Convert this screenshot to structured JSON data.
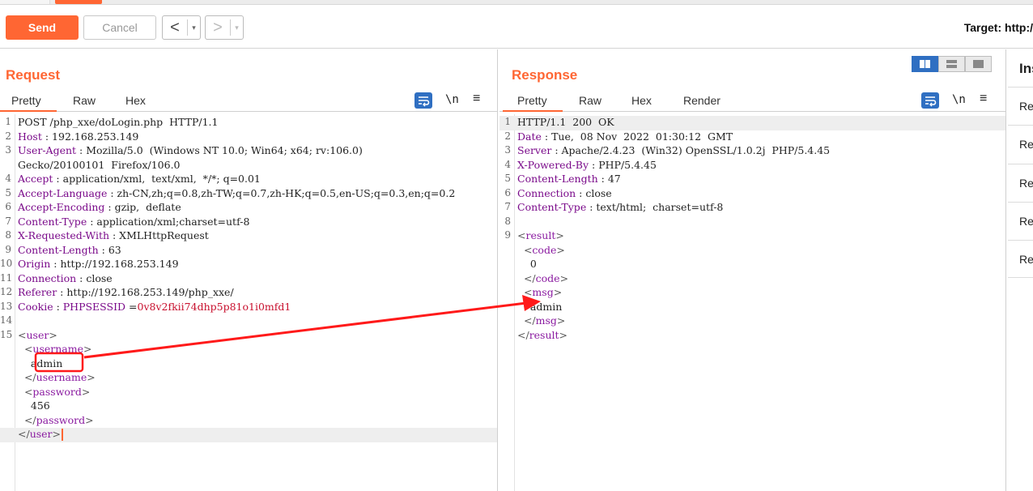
{
  "toolbar": {
    "send_label": "Send",
    "cancel_label": "Cancel",
    "back_arrow": "<",
    "fwd_arrow": ">",
    "drop_glyph": "▾",
    "target_label": "Target: http:/"
  },
  "request": {
    "title": "Request",
    "tabs": [
      "Pretty",
      "Raw",
      "Hex"
    ],
    "lines": [
      {
        "n": "1",
        "parts": [
          {
            "t": "POST /php_xxe/doLogin.php  HTTP/1.1"
          }
        ]
      },
      {
        "n": "2",
        "parts": [
          {
            "t": "Host",
            "c": "hk"
          },
          {
            "t": " : 192.168.253.149"
          }
        ]
      },
      {
        "n": "3",
        "parts": [
          {
            "t": "User-Agent",
            "c": "hk"
          },
          {
            "t": " : Mozilla/5.0  (Windows NT 10.0; Win64; x64; rv:106.0)"
          }
        ]
      },
      {
        "n": "",
        "parts": [
          {
            "t": "Gecko/20100101  Firefox/106.0"
          }
        ]
      },
      {
        "n": "4",
        "parts": [
          {
            "t": "Accept",
            "c": "hk"
          },
          {
            "t": " : application/xml,  text/xml,  */*; q=0.01"
          }
        ]
      },
      {
        "n": "5",
        "parts": [
          {
            "t": "Accept-Language",
            "c": "hk"
          },
          {
            "t": " : zh-CN,zh;q=0.8,zh-TW;q=0.7,zh-HK;q=0.5,en-US;q=0.3,en;q=0.2"
          }
        ]
      },
      {
        "n": "6",
        "parts": [
          {
            "t": "Accept-Encoding",
            "c": "hk"
          },
          {
            "t": " : gzip,  deflate"
          }
        ]
      },
      {
        "n": "7",
        "parts": [
          {
            "t": "Content-Type",
            "c": "hk"
          },
          {
            "t": " : application/xml;charset=utf-8"
          }
        ]
      },
      {
        "n": "8",
        "parts": [
          {
            "t": "X-Requested-With",
            "c": "hk"
          },
          {
            "t": " : XMLHttpRequest"
          }
        ]
      },
      {
        "n": "9",
        "parts": [
          {
            "t": "Content-Length",
            "c": "hk"
          },
          {
            "t": " : 63"
          }
        ]
      },
      {
        "n": "10",
        "parts": [
          {
            "t": "Origin",
            "c": "hk"
          },
          {
            "t": " : http://192.168.253.149"
          }
        ]
      },
      {
        "n": "11",
        "parts": [
          {
            "t": "Connection",
            "c": "hk"
          },
          {
            "t": " : close"
          }
        ]
      },
      {
        "n": "12",
        "parts": [
          {
            "t": "Referer",
            "c": "hk"
          },
          {
            "t": " : http://192.168.253.149/php_xxe/"
          }
        ]
      },
      {
        "n": "13",
        "parts": [
          {
            "t": "Cookie",
            "c": "hk"
          },
          {
            "t": " : "
          },
          {
            "t": "PHPSESSID",
            "c": "hk"
          },
          {
            "t": " ="
          },
          {
            "t": "0v8v2fkii74dhp5p81o1i0mfd1",
            "c": "cookie"
          }
        ]
      },
      {
        "n": "14",
        "parts": []
      },
      {
        "n": "15",
        "parts": [
          {
            "t": "<",
            "c": "br"
          },
          {
            "t": "user",
            "c": "tagc"
          },
          {
            "t": ">",
            "c": "br"
          }
        ]
      },
      {
        "n": "",
        "parts": [
          {
            "t": "  <",
            "c": "br"
          },
          {
            "t": "username",
            "c": "tagc"
          },
          {
            "t": ">",
            "c": "br"
          }
        ]
      },
      {
        "n": "",
        "parts": [
          {
            "t": "    admin"
          }
        ]
      },
      {
        "n": "",
        "parts": [
          {
            "t": "  </",
            "c": "br"
          },
          {
            "t": "username",
            "c": "tagc"
          },
          {
            "t": ">",
            "c": "br"
          }
        ]
      },
      {
        "n": "",
        "parts": [
          {
            "t": "  <",
            "c": "br"
          },
          {
            "t": "password",
            "c": "tagc"
          },
          {
            "t": ">",
            "c": "br"
          }
        ]
      },
      {
        "n": "",
        "parts": [
          {
            "t": "    456"
          }
        ]
      },
      {
        "n": "",
        "parts": [
          {
            "t": "  </",
            "c": "br"
          },
          {
            "t": "password",
            "c": "tagc"
          },
          {
            "t": ">",
            "c": "br"
          }
        ]
      },
      {
        "n": "",
        "parts": [
          {
            "t": "</",
            "c": "br"
          },
          {
            "t": "user",
            "c": "tagc"
          },
          {
            "t": ">",
            "c": "br"
          }
        ]
      }
    ]
  },
  "response": {
    "title": "Response",
    "tabs": [
      "Pretty",
      "Raw",
      "Hex",
      "Render"
    ],
    "lines": [
      {
        "n": "1",
        "parts": [
          {
            "t": "HTTP/1.1  200  OK"
          }
        ]
      },
      {
        "n": "2",
        "parts": [
          {
            "t": "Date",
            "c": "hk"
          },
          {
            "t": " : Tue,  08 Nov  2022  01:30:12  GMT"
          }
        ]
      },
      {
        "n": "3",
        "parts": [
          {
            "t": "Server",
            "c": "hk"
          },
          {
            "t": " : Apache/2.4.23  (Win32) OpenSSL/1.0.2j  PHP/5.4.45"
          }
        ]
      },
      {
        "n": "4",
        "parts": [
          {
            "t": "X-Powered-By",
            "c": "hk"
          },
          {
            "t": " : PHP/5.4.45"
          }
        ]
      },
      {
        "n": "5",
        "parts": [
          {
            "t": "Content-Length",
            "c": "hk"
          },
          {
            "t": " : 47"
          }
        ]
      },
      {
        "n": "6",
        "parts": [
          {
            "t": "Connection",
            "c": "hk"
          },
          {
            "t": " : close"
          }
        ]
      },
      {
        "n": "7",
        "parts": [
          {
            "t": "Content-Type",
            "c": "hk"
          },
          {
            "t": " : text/html;  charset=utf-8"
          }
        ]
      },
      {
        "n": "8",
        "parts": []
      },
      {
        "n": "9",
        "parts": [
          {
            "t": "<",
            "c": "br"
          },
          {
            "t": "result",
            "c": "tagc"
          },
          {
            "t": ">",
            "c": "br"
          }
        ]
      },
      {
        "n": "",
        "parts": [
          {
            "t": "  <",
            "c": "br"
          },
          {
            "t": "code",
            "c": "tagc"
          },
          {
            "t": ">",
            "c": "br"
          }
        ]
      },
      {
        "n": "",
        "parts": [
          {
            "t": "    0"
          }
        ]
      },
      {
        "n": "",
        "parts": [
          {
            "t": "  </",
            "c": "br"
          },
          {
            "t": "code",
            "c": "tagc"
          },
          {
            "t": ">",
            "c": "br"
          }
        ]
      },
      {
        "n": "",
        "parts": [
          {
            "t": "  <",
            "c": "br"
          },
          {
            "t": "msg",
            "c": "tagc"
          },
          {
            "t": ">",
            "c": "br"
          }
        ]
      },
      {
        "n": "",
        "parts": [
          {
            "t": "    admin"
          }
        ]
      },
      {
        "n": "",
        "parts": [
          {
            "t": "  </",
            "c": "br"
          },
          {
            "t": "msg",
            "c": "tagc"
          },
          {
            "t": ">",
            "c": "br"
          }
        ]
      },
      {
        "n": "",
        "parts": [
          {
            "t": "</",
            "c": "br"
          },
          {
            "t": "result",
            "c": "tagc"
          },
          {
            "t": ">",
            "c": "br"
          }
        ]
      }
    ]
  },
  "inspector": {
    "title": "Ins",
    "items": [
      "Re",
      "Re",
      "Re",
      "Re",
      "Re"
    ]
  },
  "colors": {
    "accent": "#ff6633",
    "header_key": "#7a0a8a",
    "xml_tag": "#8a1aa0",
    "cookie_value": "#c8102e",
    "annotation_red": "#ff1a1a",
    "layout_selected": "#2f6fc2"
  },
  "icons": {
    "wrap": "word-wrap-icon",
    "newline": "\\n",
    "menu": "≡"
  }
}
